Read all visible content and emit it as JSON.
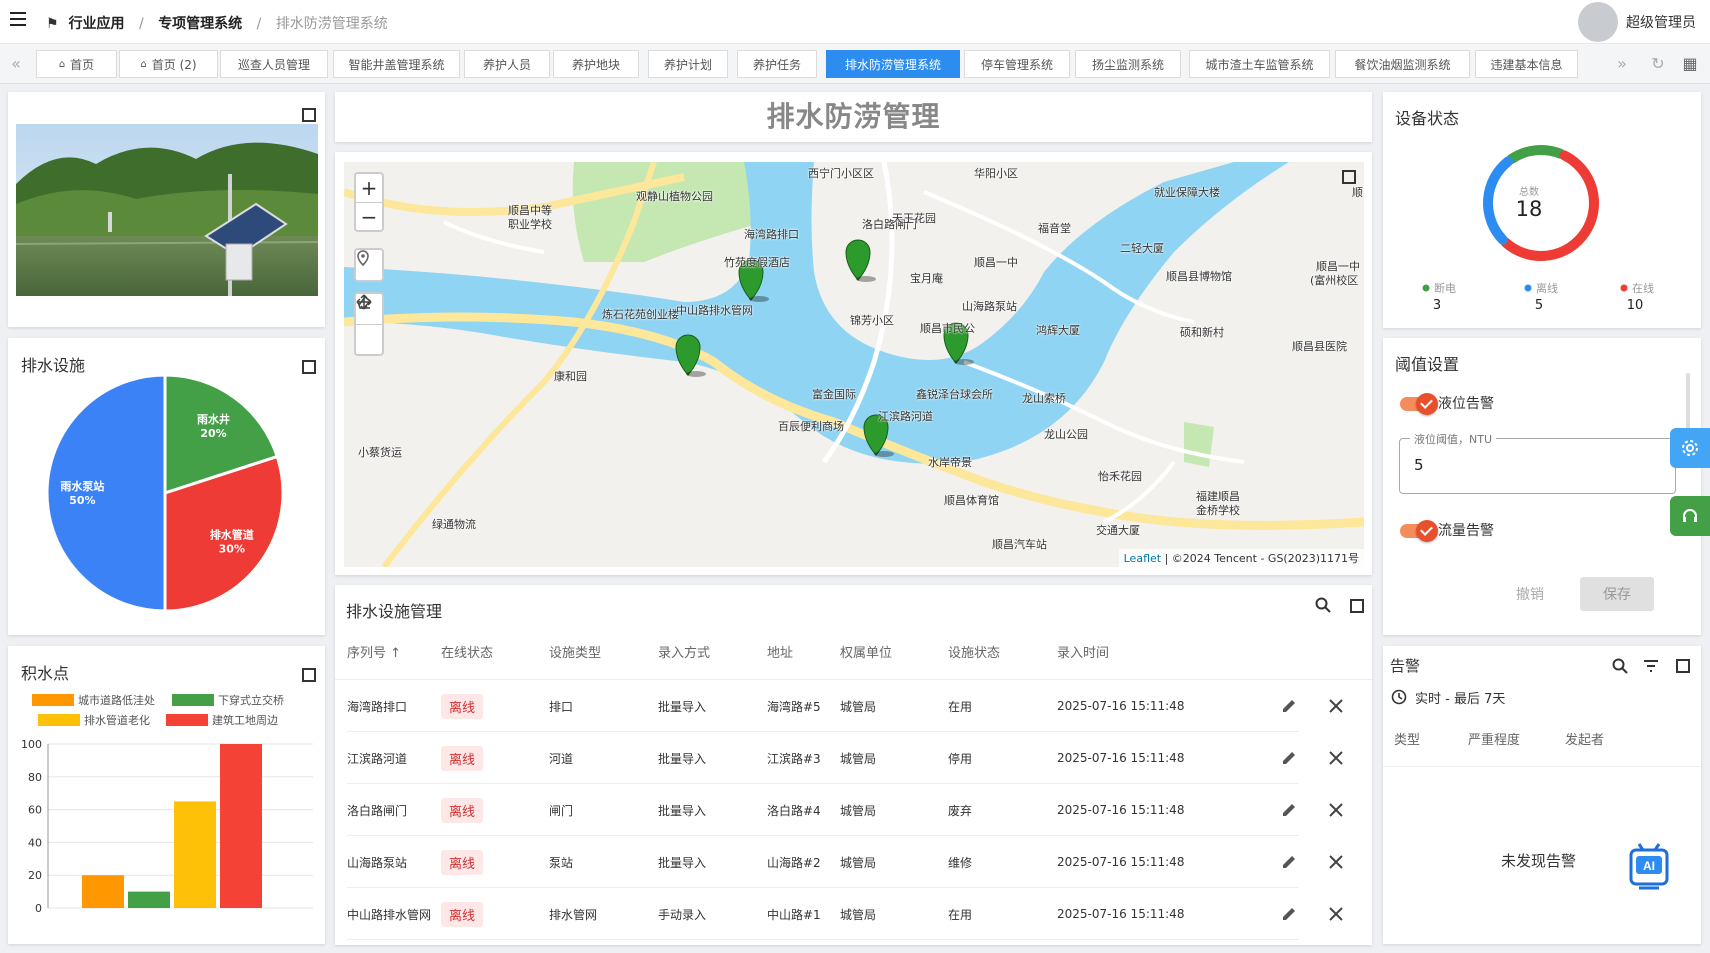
{
  "breadcrumb": {
    "item1": "行业应用",
    "item2": "专项管理系统",
    "current": "排水防涝管理系统",
    "sep": "/"
  },
  "user": {
    "name": "超级管理员"
  },
  "tabs": [
    {
      "label": "首页"
    },
    {
      "label": "首页 (2)"
    },
    {
      "label": "巡查人员管理"
    },
    {
      "label": "智能井盖管理系统"
    },
    {
      "label": "养护人员"
    },
    {
      "label": "养护地块"
    },
    {
      "label": "养护计划"
    },
    {
      "label": "养护任务"
    },
    {
      "label": "排水防涝管理系统"
    },
    {
      "label": "停车管理系统"
    },
    {
      "label": "扬尘监测系统"
    },
    {
      "label": "城市渣土车监管系统"
    },
    {
      "label": "餐饮油烟监测系统"
    },
    {
      "label": "违建基本信息"
    }
  ],
  "header": {
    "title": "排水防涝管理"
  },
  "facilities": {
    "title": "排水设施",
    "chart_data": {
      "type": "pie",
      "slices": [
        {
          "label": "雨水泵站",
          "value": 50,
          "pct": "50%",
          "color": "#3b82f6"
        },
        {
          "label": "雨水井",
          "value": 20,
          "pct": "20%",
          "color": "#43a047"
        },
        {
          "label": "排水管道",
          "value": 30,
          "pct": "30%",
          "color": "#ef3b36"
        }
      ]
    }
  },
  "waterlog": {
    "title": "积水点",
    "chart_data": {
      "type": "bar",
      "categories": [
        "城市道路低洼处",
        "下穿式立交桥",
        "排水管道老化",
        "建筑工地周边"
      ],
      "values": [
        20,
        10,
        65,
        100
      ],
      "colors": [
        "#ff9800",
        "#43a047",
        "#ffc107",
        "#f44336"
      ],
      "ylim": [
        0,
        100
      ],
      "yticks": [
        0,
        20,
        40,
        60,
        80,
        100
      ]
    }
  },
  "map": {
    "labels": [
      {
        "text": "西宁门小区区"
      },
      {
        "text": "华阳小区"
      },
      {
        "text": "观静山植物公园"
      },
      {
        "text": "顺昌中等"
      },
      {
        "text": "职业学校"
      },
      {
        "text": "就业保障大楼"
      },
      {
        "text": "顺"
      },
      {
        "text": "洛白路闸门"
      },
      {
        "text": "天王花园"
      },
      {
        "text": "福音堂"
      },
      {
        "text": "海湾路排口"
      },
      {
        "text": "竹苑度假酒店"
      },
      {
        "text": "二轻大厦"
      },
      {
        "text": "宝月庵"
      },
      {
        "text": "顺昌一中"
      },
      {
        "text": "顺昌县博物馆"
      },
      {
        "text": "顺昌一中"
      },
      {
        "text": "(富州校区"
      },
      {
        "text": "山海路泵站"
      },
      {
        "text": "炼石花苑创业楼"
      },
      {
        "text": "中山路排水管网"
      },
      {
        "text": "锦芳小区"
      },
      {
        "text": "顺昌市民公"
      },
      {
        "text": "鸿辉大厦"
      },
      {
        "text": "硕和新村"
      },
      {
        "text": "顺昌县医院"
      },
      {
        "text": "康和园"
      },
      {
        "text": "富金国际"
      },
      {
        "text": "鑫锐泽台球会所"
      },
      {
        "text": "龙山索桥"
      },
      {
        "text": "百辰便利商场"
      },
      {
        "text": "江滨路河道"
      },
      {
        "text": "龙山公园"
      },
      {
        "text": "小蔡货运"
      },
      {
        "text": "水岸帝景"
      },
      {
        "text": "怡禾花园"
      },
      {
        "text": "福建顺昌"
      },
      {
        "text": "金桥学校"
      },
      {
        "text": "顺昌体育馆"
      },
      {
        "text": "绿通物流"
      },
      {
        "text": "交通大厦"
      },
      {
        "text": "顺昌汽车站"
      }
    ],
    "zoom_in": "+",
    "zoom_out": "−",
    "attribution_link": "Leaflet",
    "attribution_text": " | ©2024 Tencent - GS(2023)1171号"
  },
  "table": {
    "title": "排水设施管理",
    "columns": [
      "序列号 ↑",
      "在线状态",
      "设施类型",
      "录入方式",
      "地址",
      "权属单位",
      "设施状态",
      "录入时间"
    ],
    "rows": [
      {
        "name": "海湾路排口",
        "online": "离线",
        "type": "排口",
        "method": "批量导入",
        "address": "海湾路#5",
        "owner": "城管局",
        "status": "在用",
        "time": "2025-07-16 15:11:48"
      },
      {
        "name": "江滨路河道",
        "online": "离线",
        "type": "河道",
        "method": "批量导入",
        "address": "江滨路#3",
        "owner": "城管局",
        "status": "停用",
        "time": "2025-07-16 15:11:48"
      },
      {
        "name": "洛白路闸门",
        "online": "离线",
        "type": "闸门",
        "method": "批量导入",
        "address": "洛白路#4",
        "owner": "城管局",
        "status": "废弃",
        "time": "2025-07-16 15:11:48"
      },
      {
        "name": "山海路泵站",
        "online": "离线",
        "type": "泵站",
        "method": "批量导入",
        "address": "山海路#2",
        "owner": "城管局",
        "status": "维修",
        "time": "2025-07-16 15:11:48"
      },
      {
        "name": "中山路排水管网",
        "online": "离线",
        "type": "排水管网",
        "method": "手动录入",
        "address": "中山路#1",
        "owner": "城管局",
        "status": "在用",
        "time": "2025-07-16 15:11:48"
      }
    ]
  },
  "device": {
    "title": "设备状态",
    "total_label": "总数",
    "total": "18",
    "chart_data": {
      "type": "donut",
      "items": [
        {
          "label": "断电",
          "value": 3,
          "color": "#43a047"
        },
        {
          "label": "离线",
          "value": 5,
          "color": "#2d8cf0"
        },
        {
          "label": "在线",
          "value": 10,
          "color": "#ef3b36"
        }
      ]
    }
  },
  "threshold": {
    "title": "阈值设置",
    "level_alarm": "液位告警",
    "level_field_label": "液位阈值，NTU",
    "level_value": "5",
    "flow_alarm": "流量告警",
    "cancel": "撤销",
    "save": "保存"
  },
  "alarm": {
    "title": "告警",
    "filter": "实时 - 最后 7天",
    "columns": [
      "类型",
      "严重程度",
      "发起者"
    ],
    "empty": "未发现告警"
  }
}
